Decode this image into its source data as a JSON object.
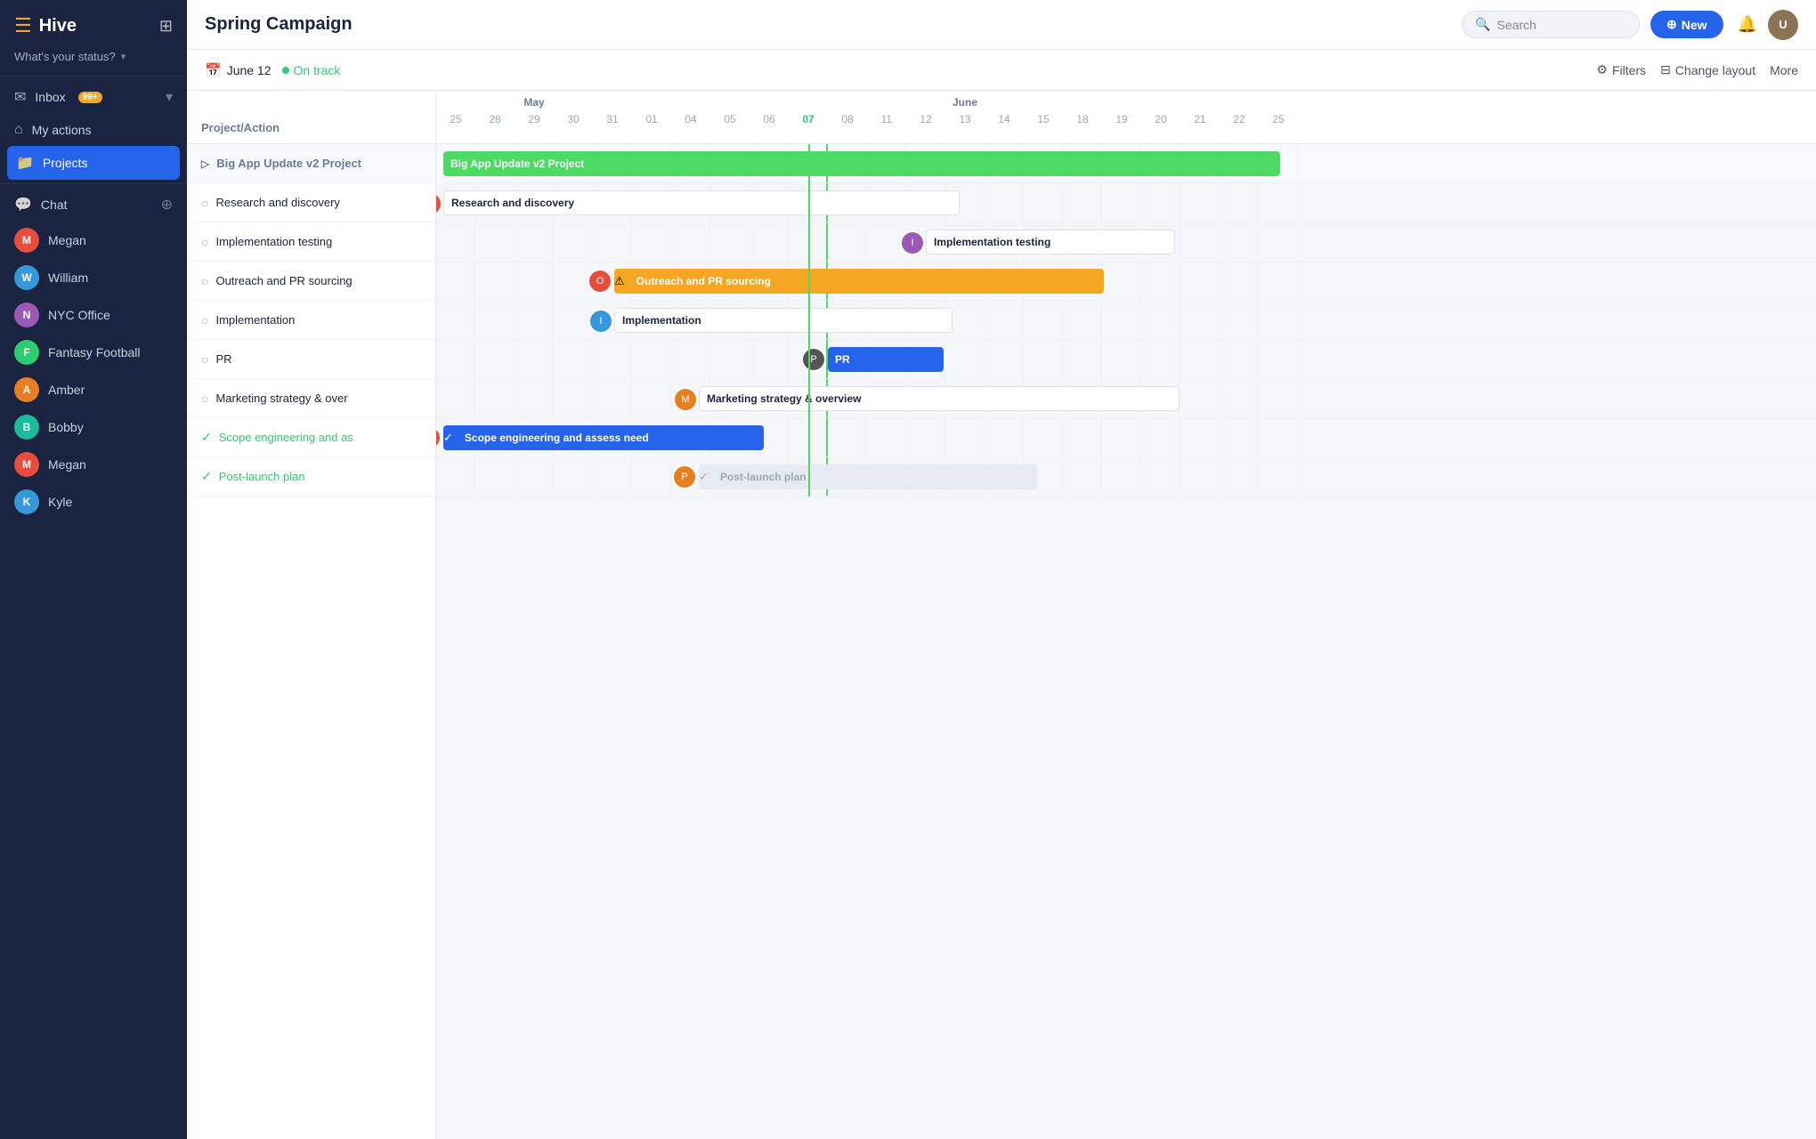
{
  "app": {
    "name": "Hive"
  },
  "sidebar": {
    "status_placeholder": "What's your status?",
    "inbox_label": "Inbox",
    "inbox_badge": "99+",
    "my_actions_label": "My actions",
    "projects_label": "Projects",
    "chat_label": "Chat",
    "contacts": [
      {
        "name": "Megan",
        "initials": "M",
        "color": "av-1"
      },
      {
        "name": "William",
        "initials": "W",
        "color": "av-2"
      },
      {
        "name": "NYC Office",
        "initials": "N",
        "color": "av-3"
      },
      {
        "name": "Fantasy Football",
        "initials": "F",
        "color": "av-4"
      },
      {
        "name": "Amber",
        "initials": "A",
        "color": "av-5"
      },
      {
        "name": "Bobby",
        "initials": "B",
        "color": "av-6"
      },
      {
        "name": "Megan",
        "initials": "M",
        "color": "av-1"
      },
      {
        "name": "Kyle",
        "initials": "K",
        "color": "av-2"
      }
    ]
  },
  "topbar": {
    "title": "Spring Campaign",
    "search_placeholder": "Search",
    "new_label": "New"
  },
  "subbar": {
    "date": "June 12",
    "status": "On track",
    "filters_label": "Filters",
    "change_layout_label": "Change layout",
    "more_label": "More"
  },
  "gantt": {
    "left_header": "Project/Action",
    "project_group": "Big App Update v2 Project",
    "tasks": [
      {
        "name": "Research and discovery",
        "done": false
      },
      {
        "name": "Implementation testing",
        "done": false
      },
      {
        "name": "Outreach and PR sourcing",
        "done": false
      },
      {
        "name": "Implementation",
        "done": false
      },
      {
        "name": "PR",
        "done": false
      },
      {
        "name": "Marketing strategy & over",
        "done": false
      },
      {
        "name": "Scope engineering and as",
        "done": true
      },
      {
        "name": "Post-launch plan",
        "done": true
      }
    ],
    "months": [
      {
        "label": "May",
        "span": 5
      },
      {
        "label": "June",
        "span": 17
      }
    ],
    "days": [
      "25",
      "28",
      "29",
      "30",
      "31",
      "01",
      "04",
      "05",
      "06",
      "07",
      "08",
      "11",
      "12",
      "13",
      "14",
      "15",
      "18",
      "19",
      "20",
      "21",
      "22",
      "25"
    ]
  }
}
